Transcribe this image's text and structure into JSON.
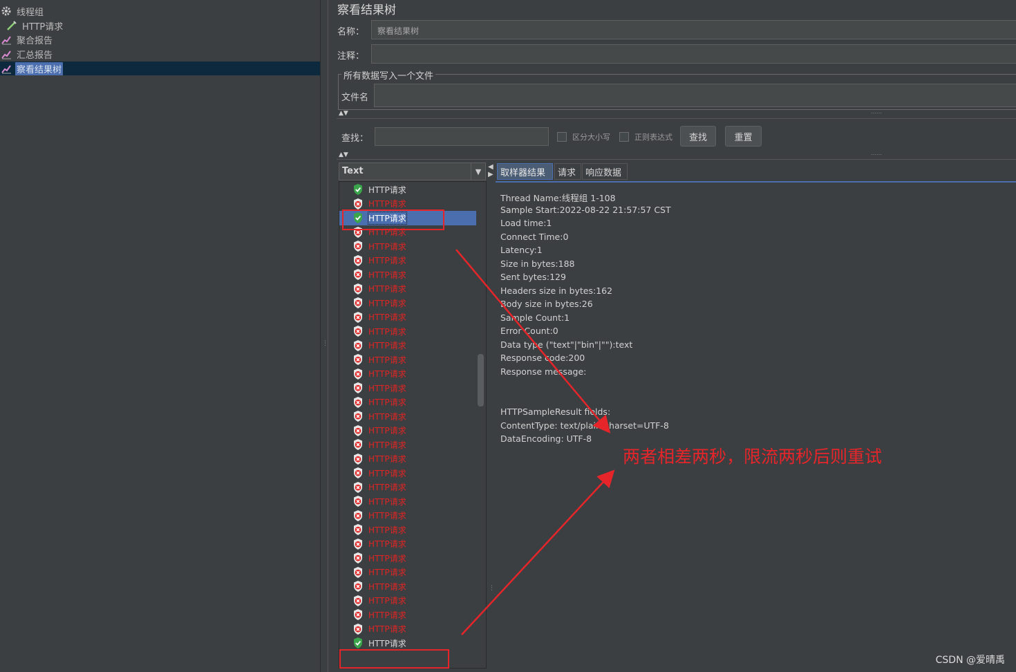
{
  "tree": {
    "items": [
      {
        "label": "线程组",
        "icon": "gear-icon"
      },
      {
        "label": "HTTP请求",
        "icon": "pipette-icon"
      },
      {
        "label": "聚合报告",
        "icon": "chart-icon"
      },
      {
        "label": "汇总报告",
        "icon": "chart-icon"
      },
      {
        "label": "察看结果树",
        "icon": "chart-icon",
        "selected": true
      }
    ]
  },
  "panel": {
    "title": "察看结果树",
    "name_label": "名称：",
    "name_value": "察看结果树",
    "comment_label": "注释：",
    "comment_value": "",
    "file_group_label": "所有数据写入一个文件",
    "filename_label": "文件名",
    "filename_value": ""
  },
  "search": {
    "label": "查找：",
    "value": "",
    "case_label": "区分大小写",
    "regex_label": "正则表达式",
    "find_button": "查找",
    "reset_button": "重置"
  },
  "renderer": {
    "selected": "Text"
  },
  "results": {
    "label": "HTTP请求",
    "status": [
      "ok",
      "err",
      "ok",
      "err",
      "err",
      "err",
      "err",
      "err",
      "err",
      "err",
      "err",
      "err",
      "err",
      "err",
      "err",
      "err",
      "err",
      "err",
      "err",
      "err",
      "err",
      "err",
      "err",
      "err",
      "err",
      "err",
      "err",
      "err",
      "err",
      "err",
      "err",
      "err",
      "ok"
    ],
    "selected_index": 2
  },
  "tabs": {
    "sampler_result": "取样器结果",
    "request": "请求",
    "response_data": "响应数据"
  },
  "detail": {
    "lines": [
      "Thread Name:线程组 1-108",
      "Sample Start:2022-08-22 21:57:57 CST",
      "Load time:1",
      "Connect Time:0",
      "Latency:1",
      "Size in bytes:188",
      "Sent bytes:129",
      "Headers size in bytes:162",
      "Body size in bytes:26",
      "Sample Count:1",
      "Error Count:0",
      "Data type (\"text\"|\"bin\"|\"\"):text",
      "Response code:200",
      "Response message:",
      "",
      "",
      "HTTPSampleResult fields:",
      "ContentType: text/plain;charset=UTF-8",
      "DataEncoding: UTF-8"
    ]
  },
  "annotation": "两者相差两秒，限流两秒后则重试",
  "watermark": "CSDN @爱晴禹",
  "colors": {
    "ok": "#3aa54a",
    "error": "#e02424",
    "selection": "#4b6eaf",
    "annotation": "#e5252a"
  }
}
